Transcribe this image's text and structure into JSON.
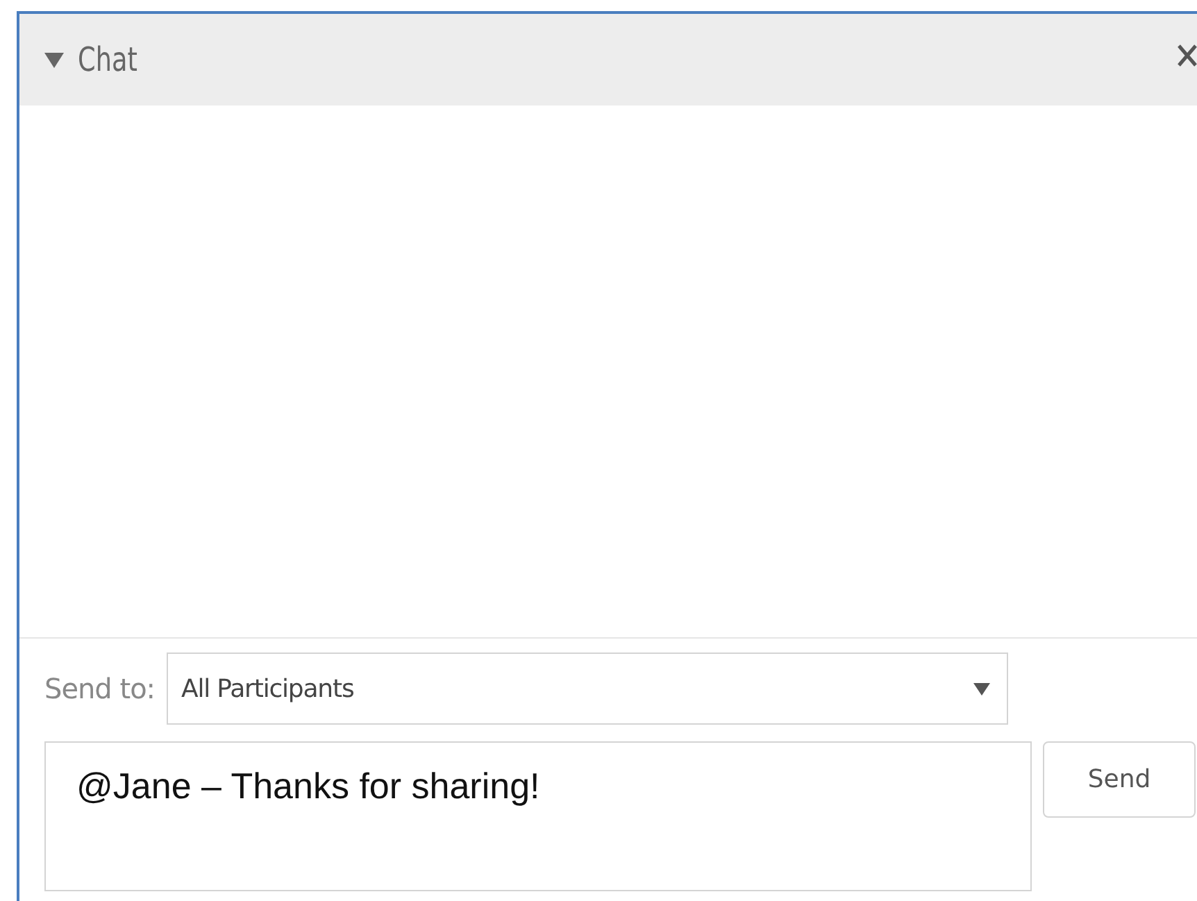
{
  "panel": {
    "title": "Chat",
    "expanded": true
  },
  "send_to": {
    "label": "Send to:",
    "value": "All Participants"
  },
  "message": {
    "value": "@Jane – Thanks for sharing!"
  },
  "send_button": {
    "label": "Send"
  }
}
